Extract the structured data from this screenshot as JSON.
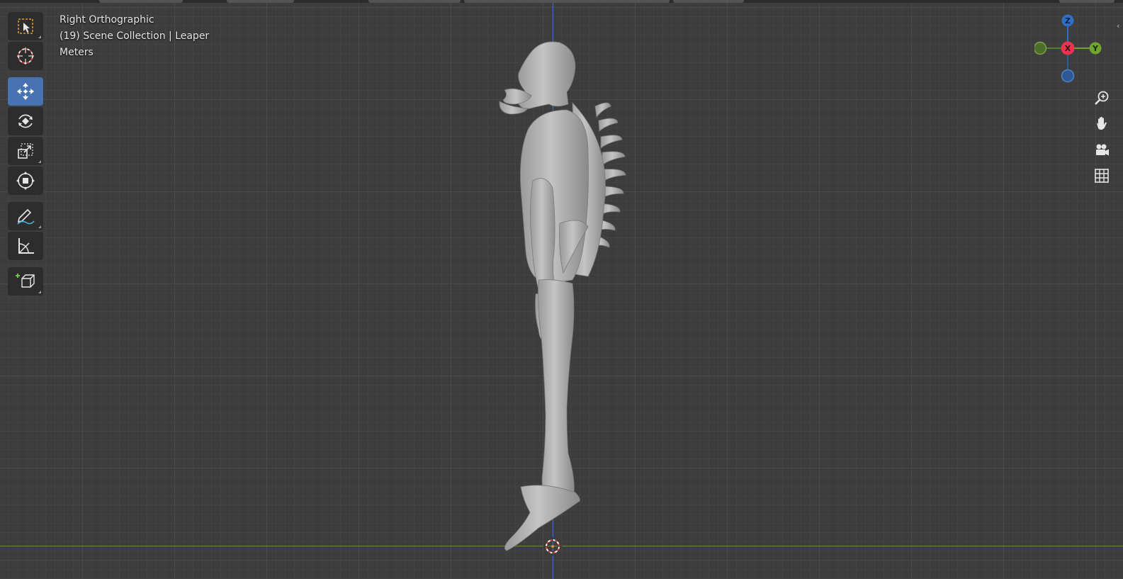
{
  "viewport": {
    "view_name": "Right Orthographic",
    "collection_info": "(19) Scene Collection | Leaper",
    "units": "Meters"
  },
  "toolbar": {
    "tools": [
      {
        "id": "select-box",
        "icon": "select-box-icon",
        "active": false
      },
      {
        "id": "cursor",
        "icon": "cursor-icon",
        "active": false
      },
      {
        "id": "move",
        "icon": "move-icon",
        "active": true
      },
      {
        "id": "rotate",
        "icon": "rotate-icon",
        "active": false
      },
      {
        "id": "scale",
        "icon": "scale-icon",
        "active": false
      },
      {
        "id": "transform",
        "icon": "transform-icon",
        "active": false
      },
      {
        "id": "annotate",
        "icon": "annotate-icon",
        "active": false
      },
      {
        "id": "measure",
        "icon": "measure-icon",
        "active": false
      },
      {
        "id": "add-cube",
        "icon": "add-cube-icon",
        "active": false
      }
    ]
  },
  "gizmo": {
    "z_label": "Z",
    "x_label": "X",
    "y_label": "Y",
    "colors": {
      "z": "#2f6fc7",
      "x": "#e8344f",
      "y": "#6fa52c",
      "neg_y": "#557a33",
      "neg_z": "#2f5c94"
    }
  },
  "nav_controls": [
    {
      "name": "zoom",
      "icon": "zoom-icon"
    },
    {
      "name": "pan",
      "icon": "hand-icon"
    },
    {
      "name": "camera",
      "icon": "camera-icon"
    },
    {
      "name": "ortho-toggle",
      "icon": "grid-icon"
    }
  ],
  "scene": {
    "object": "Leaper",
    "axis_colors": {
      "z": "#3b6fb0",
      "y": "#6a8c3b"
    }
  }
}
